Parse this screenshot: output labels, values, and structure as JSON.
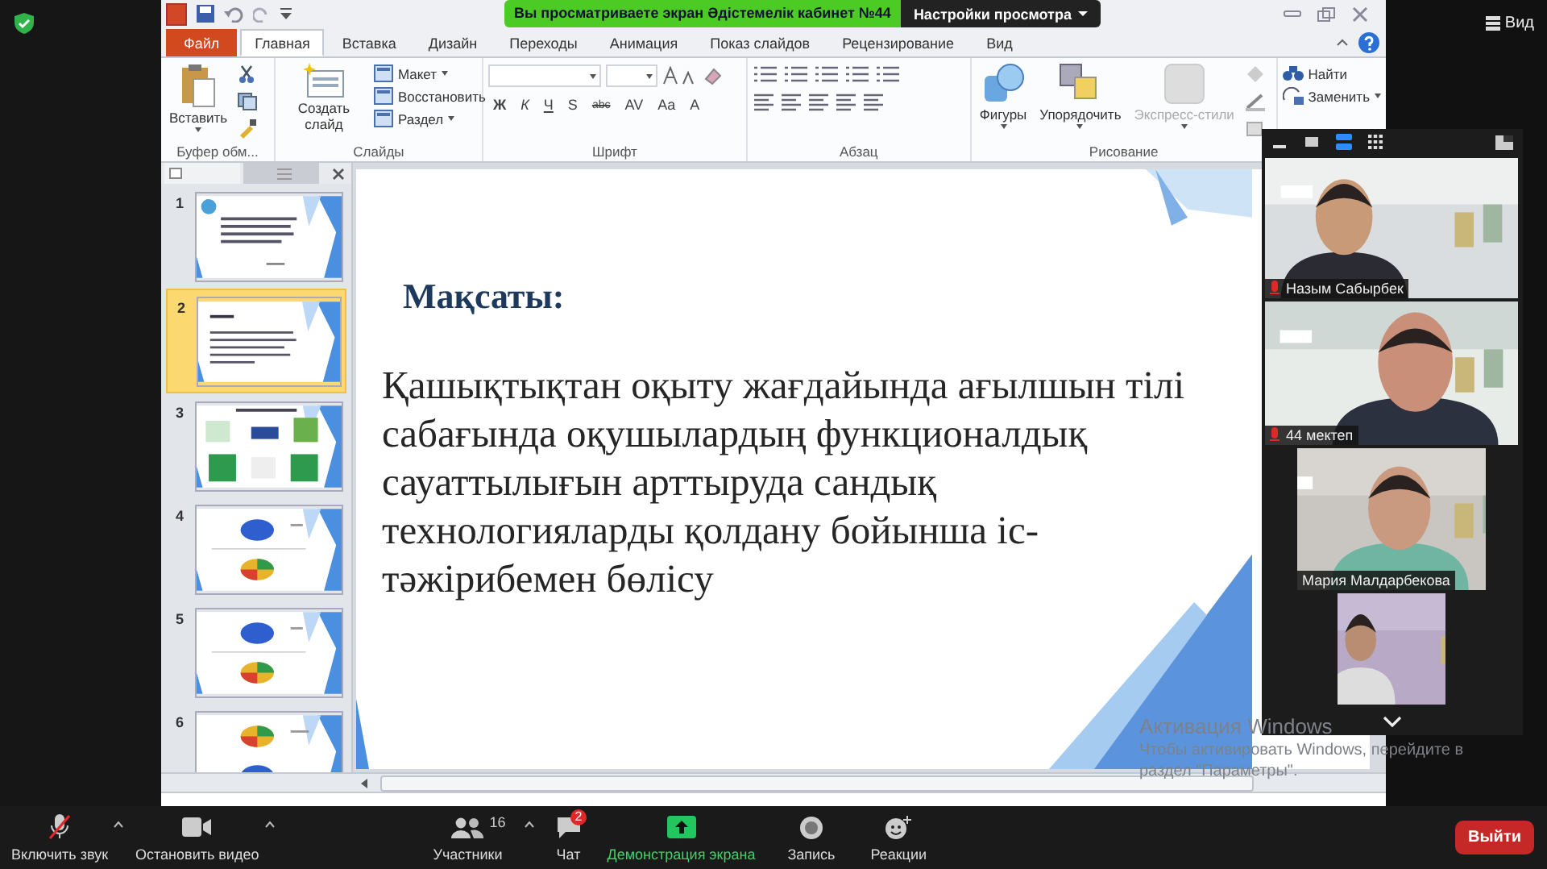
{
  "top_bar": {
    "view_label": "Вид"
  },
  "powerpoint": {
    "banner": "Вы просматриваете экран Әдістемелік кабинет №44",
    "view_settings": "Настройки просмотра",
    "tabs": [
      {
        "label": "Файл",
        "kind": "file",
        "selected": false
      },
      {
        "label": "Главная",
        "kind": "tab",
        "selected": true
      },
      {
        "label": "Вставка",
        "kind": "tab",
        "selected": false
      },
      {
        "label": "Дизайн",
        "kind": "tab",
        "selected": false
      },
      {
        "label": "Переходы",
        "kind": "tab",
        "selected": false
      },
      {
        "label": "Анимация",
        "kind": "tab",
        "selected": false
      },
      {
        "label": "Показ слайдов",
        "kind": "tab",
        "selected": false
      },
      {
        "label": "Рецензирование",
        "kind": "tab",
        "selected": false
      },
      {
        "label": "Вид",
        "kind": "tab",
        "selected": false
      }
    ],
    "ribbon": [
      {
        "kind": "clipboard",
        "label": "Буфер обм...",
        "big": [
          {
            "label": "Вставить",
            "disabled": false
          }
        ]
      },
      {
        "kind": "slides",
        "label": "Слайды",
        "big": [
          {
            "label": "Создать слайд",
            "disabled": false
          }
        ],
        "small": [
          "Макет",
          "Восстановить",
          "Раздел"
        ]
      },
      {
        "kind": "font",
        "label": "Шрифт",
        "format": [
          "Ж",
          "К",
          "Ч",
          "S",
          "abc",
          "AV",
          "Aa",
          "A"
        ]
      },
      {
        "kind": "paragraph",
        "label": "Абзац"
      },
      {
        "kind": "drawing",
        "label": "Рисование",
        "big": [
          {
            "label": "Фигуры",
            "disabled": false
          },
          {
            "label": "Упорядочить",
            "disabled": false
          },
          {
            "label": "Экспресс-стили",
            "disabled": true
          }
        ]
      },
      {
        "kind": "editing",
        "small": [
          "Найти",
          "Заменить"
        ]
      }
    ],
    "thumbnails": [
      {
        "number": "1",
        "kind": "title",
        "selected": false
      },
      {
        "number": "2",
        "kind": "text",
        "selected": true
      },
      {
        "number": "3",
        "kind": "images",
        "selected": false
      },
      {
        "number": "4",
        "kind": "circlepie",
        "selected": false
      },
      {
        "number": "5",
        "kind": "circlepie",
        "selected": false
      },
      {
        "number": "6",
        "kind": "piecircle",
        "selected": false
      }
    ],
    "slide": {
      "title": "Мақсаты:",
      "body": "Қашықтықтан оқыту жағдайында ағылшын тілі сабағында оқушылардың функционалдық сауаттылығын арттыруда сандық технологияларды қолдану бойынша іс-тәжірибемен бөлісу"
    }
  },
  "video_panel": {
    "participants": [
      {
        "name": "Назым Сабырбек",
        "muted": true
      },
      {
        "name": "44 мектеп",
        "muted": true
      },
      {
        "name": "Мария Малдарбекова",
        "muted": false
      },
      {
        "muted": false
      }
    ]
  },
  "windows_notice": [
    "Активация Windows",
    "Чтобы активировать Windows, перейдите в",
    "раздел \"Параметры\"."
  ],
  "toolbar": {
    "items": [
      {
        "label": "Включить звук",
        "kind": "mic",
        "caret": true,
        "highlighted": false
      },
      {
        "label": "Остановить видео",
        "kind": "video",
        "caret": true,
        "highlighted": false
      },
      {
        "label": "Участники",
        "kind": "participants",
        "count": "16",
        "caret": true,
        "highlighted": false
      },
      {
        "label": "Чат",
        "kind": "chat",
        "badge": "2",
        "caret": false,
        "highlighted": false
      },
      {
        "label": "Демонстрация экрана",
        "kind": "share",
        "caret": false,
        "highlighted": true
      },
      {
        "label": "Запись",
        "kind": "record",
        "caret": false,
        "highlighted": false
      },
      {
        "label": "Реакции",
        "kind": "reactions",
        "caret": false,
        "highlighted": false
      }
    ],
    "leave": "Выйти"
  }
}
